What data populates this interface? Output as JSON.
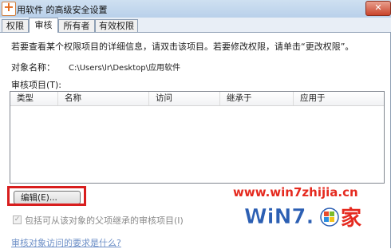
{
  "window": {
    "title": "用软件 的高级安全设置",
    "close_label": "✕"
  },
  "tabs": [
    {
      "label": "权限",
      "active": false
    },
    {
      "label": "审核",
      "active": true
    },
    {
      "label": "所有者",
      "active": false
    },
    {
      "label": "有效权限",
      "active": false
    }
  ],
  "panel": {
    "instruction": "若要查看某个权限项目的详细信息，请双击该项目。若要修改权限，请单击“更改权限”。",
    "object_name_label": "对象名称：",
    "object_name_value": "C:\\Users\\lr\\Desktop\\应用软件",
    "entries_label": "审核项目(T):",
    "columns": [
      "类型",
      "名称",
      "访问",
      "继承于",
      "应用于"
    ],
    "rows": [],
    "edit_button": "编辑(E)...",
    "inherit_checkbox": {
      "label": "包括可从该对象的父项继承的审核项目(I)",
      "checked": true,
      "disabled": true
    },
    "help_link": "审核对象访问的要求是什么?"
  },
  "watermark": {
    "url": "www.win7zhijia.cn",
    "logo_text": "WiN7.",
    "logo_char": "家"
  },
  "colors": {
    "highlight": "#d81e1e",
    "watermark_red": "#e52a1f",
    "watermark_blue": "#2c5fb3",
    "link": "#6d8fc7"
  }
}
